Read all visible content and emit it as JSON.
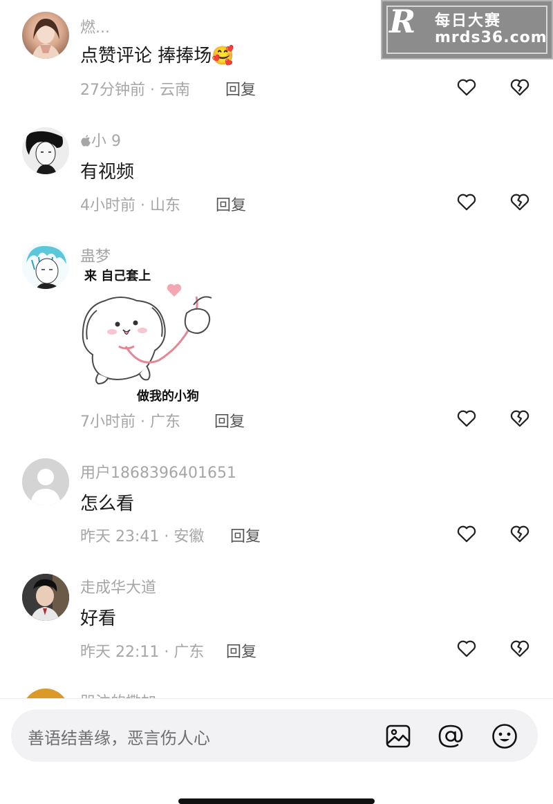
{
  "watermark": {
    "logo": "R",
    "title": "每日大赛",
    "url": "mrds36.com"
  },
  "comments": [
    {
      "username": "燃...",
      "content": "点赞评论 捧捧场🥰",
      "time": "27分钟前 · 云南",
      "reply": "回复",
      "avatar": "photo-avatar-female"
    },
    {
      "username": "小 9",
      "content": "有视频",
      "time": "4小时前 · 山东",
      "reply": "回复",
      "avatar": "photo-avatar-bw"
    },
    {
      "username": "蛊梦",
      "sticker_top": "来 自己套上",
      "sticker_bottom": "做我的小狗",
      "time": "7小时前 · 广东",
      "reply": "回复",
      "avatar": "photo-avatar-anime"
    },
    {
      "username": "用户1868396401651",
      "content": "怎么看",
      "time": "昨天 23:41 · 安徽",
      "reply": "回复",
      "avatar": "default-avatar"
    },
    {
      "username": "走成华大道",
      "content": "好看",
      "time": "昨天 22:11 · 广东",
      "reply": "回复",
      "avatar": "photo-avatar-male"
    },
    {
      "username": "哭泣的撒加"
    }
  ],
  "input": {
    "placeholder": "善语结善缘，恶言伤人心"
  },
  "icons": {
    "like": "heart-outline-icon",
    "dislike": "broken-heart-icon",
    "image": "image-icon",
    "mention": "at-icon",
    "emoji": "emoji-icon",
    "apple": "apple-icon"
  },
  "colors": {
    "secondary_text": "#a6a6a6",
    "primary_text": "#1a1a1a",
    "input_bg": "#f2f2f4"
  }
}
